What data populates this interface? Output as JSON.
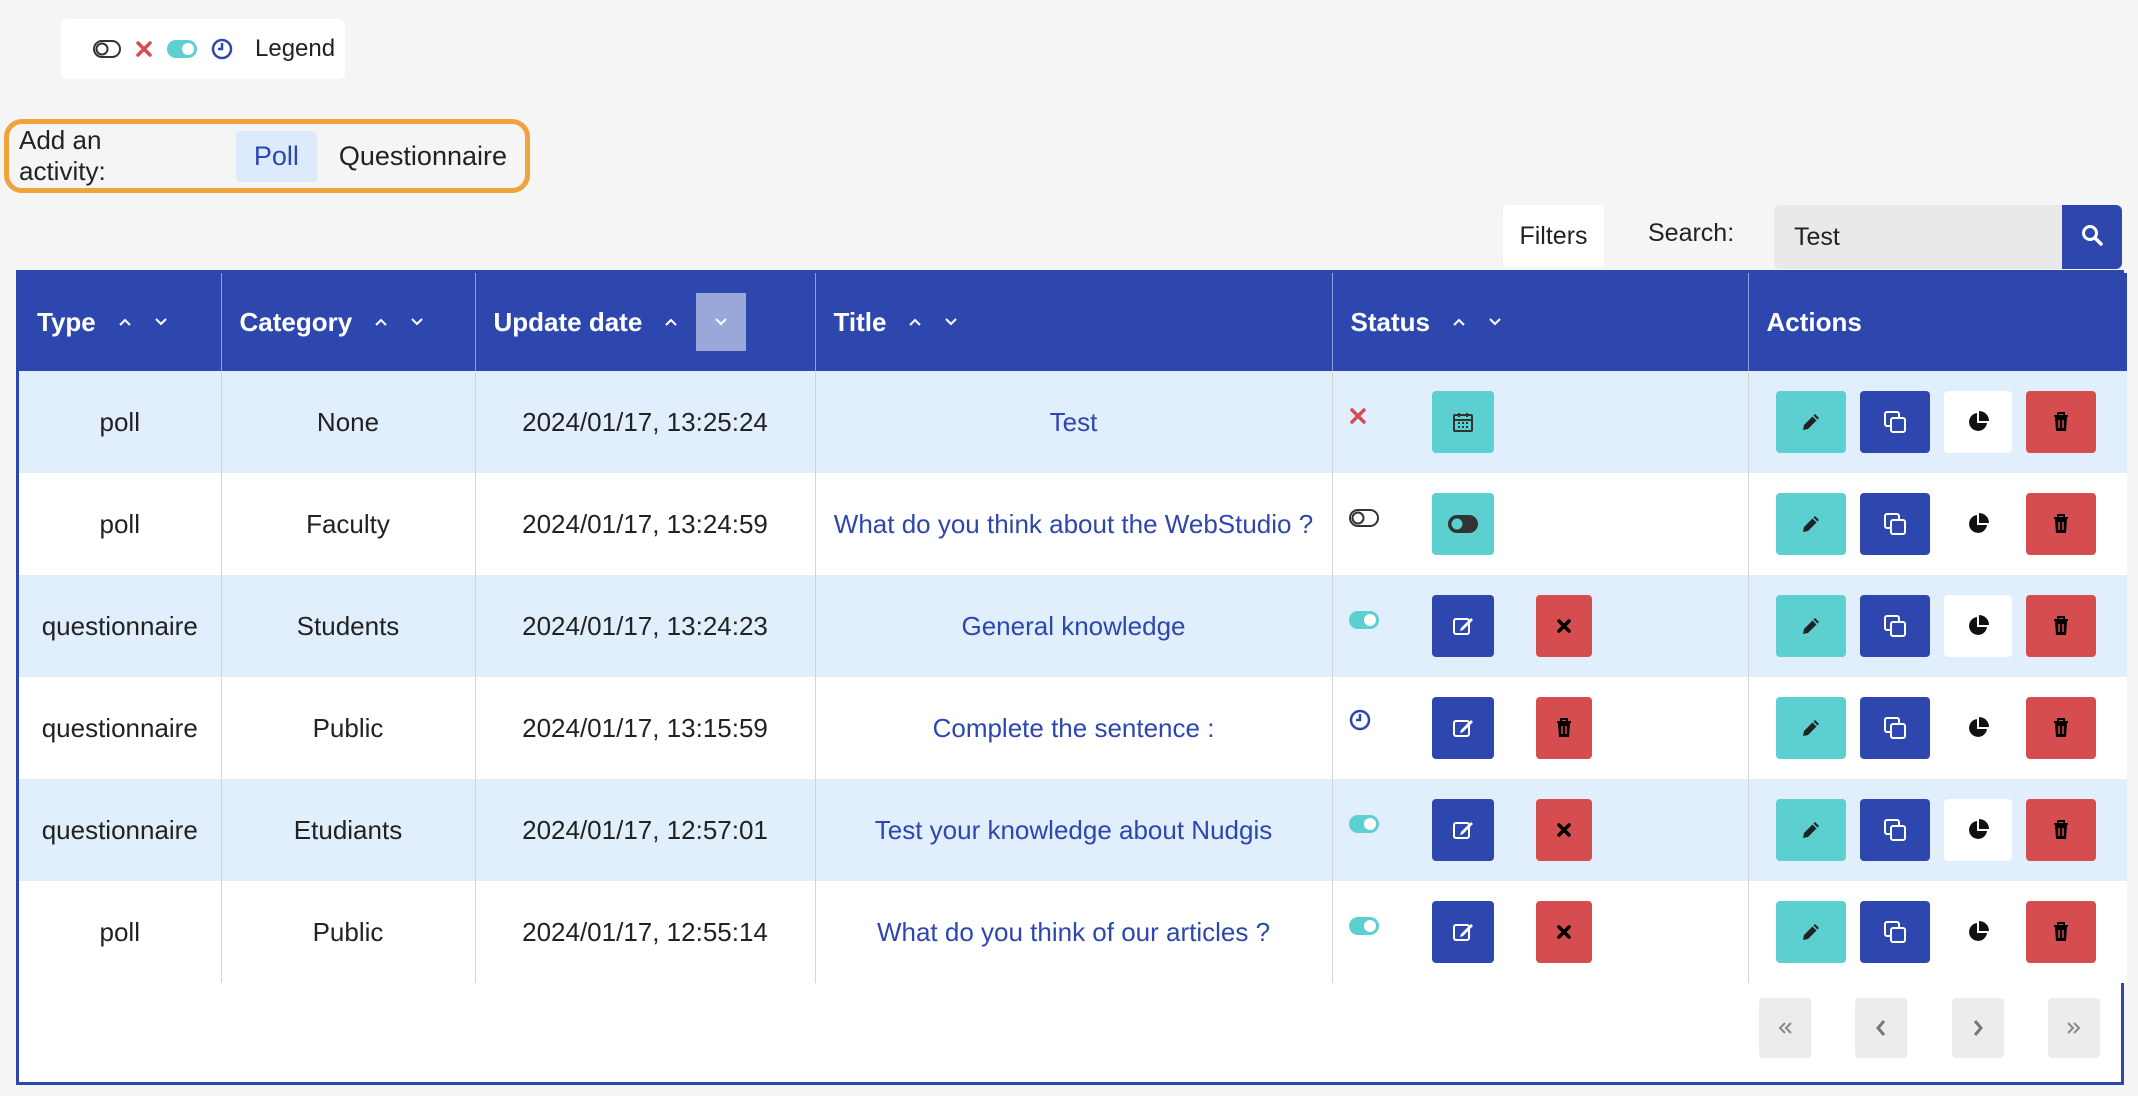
{
  "legend": {
    "label": "Legend"
  },
  "add_activity": {
    "label": "Add an activity:",
    "poll": "Poll",
    "questionnaire": "Questionnaire"
  },
  "toolbar": {
    "filters": "Filters",
    "search_label": "Search:",
    "search_value": "Test"
  },
  "table": {
    "headers": [
      "Type",
      "Category",
      "Update date",
      "Title",
      "Status",
      "Actions"
    ],
    "rows": [
      {
        "type": "poll",
        "category": "None",
        "date": "2024/01/17, 13:25:24",
        "title": "Test",
        "status": "closed"
      },
      {
        "type": "poll",
        "category": "Faculty",
        "date": "2024/01/17, 13:24:59",
        "title": "What do you think about the WebStudio ?",
        "status": "draft"
      },
      {
        "type": "questionnaire",
        "category": "Students",
        "date": "2024/01/17, 13:24:23",
        "title": "General knowledge",
        "status": "published"
      },
      {
        "type": "questionnaire",
        "category": "Public",
        "date": "2024/01/17, 13:15:59",
        "title": "Complete the sentence :",
        "status": "scheduled"
      },
      {
        "type": "questionnaire",
        "category": "Etudiants",
        "date": "2024/01/17, 12:57:01",
        "title": "Test your knowledge about Nudgis",
        "status": "published"
      },
      {
        "type": "poll",
        "category": "Public",
        "date": "2024/01/17, 12:55:14",
        "title": "What do you think of our articles ?",
        "status": "published"
      }
    ]
  },
  "colors": {
    "primary": "#2d47ae",
    "teal": "#5ccfd0",
    "danger": "#d54d4f",
    "row_alt": "#e1eefb",
    "highlight": "#f0a33b"
  }
}
